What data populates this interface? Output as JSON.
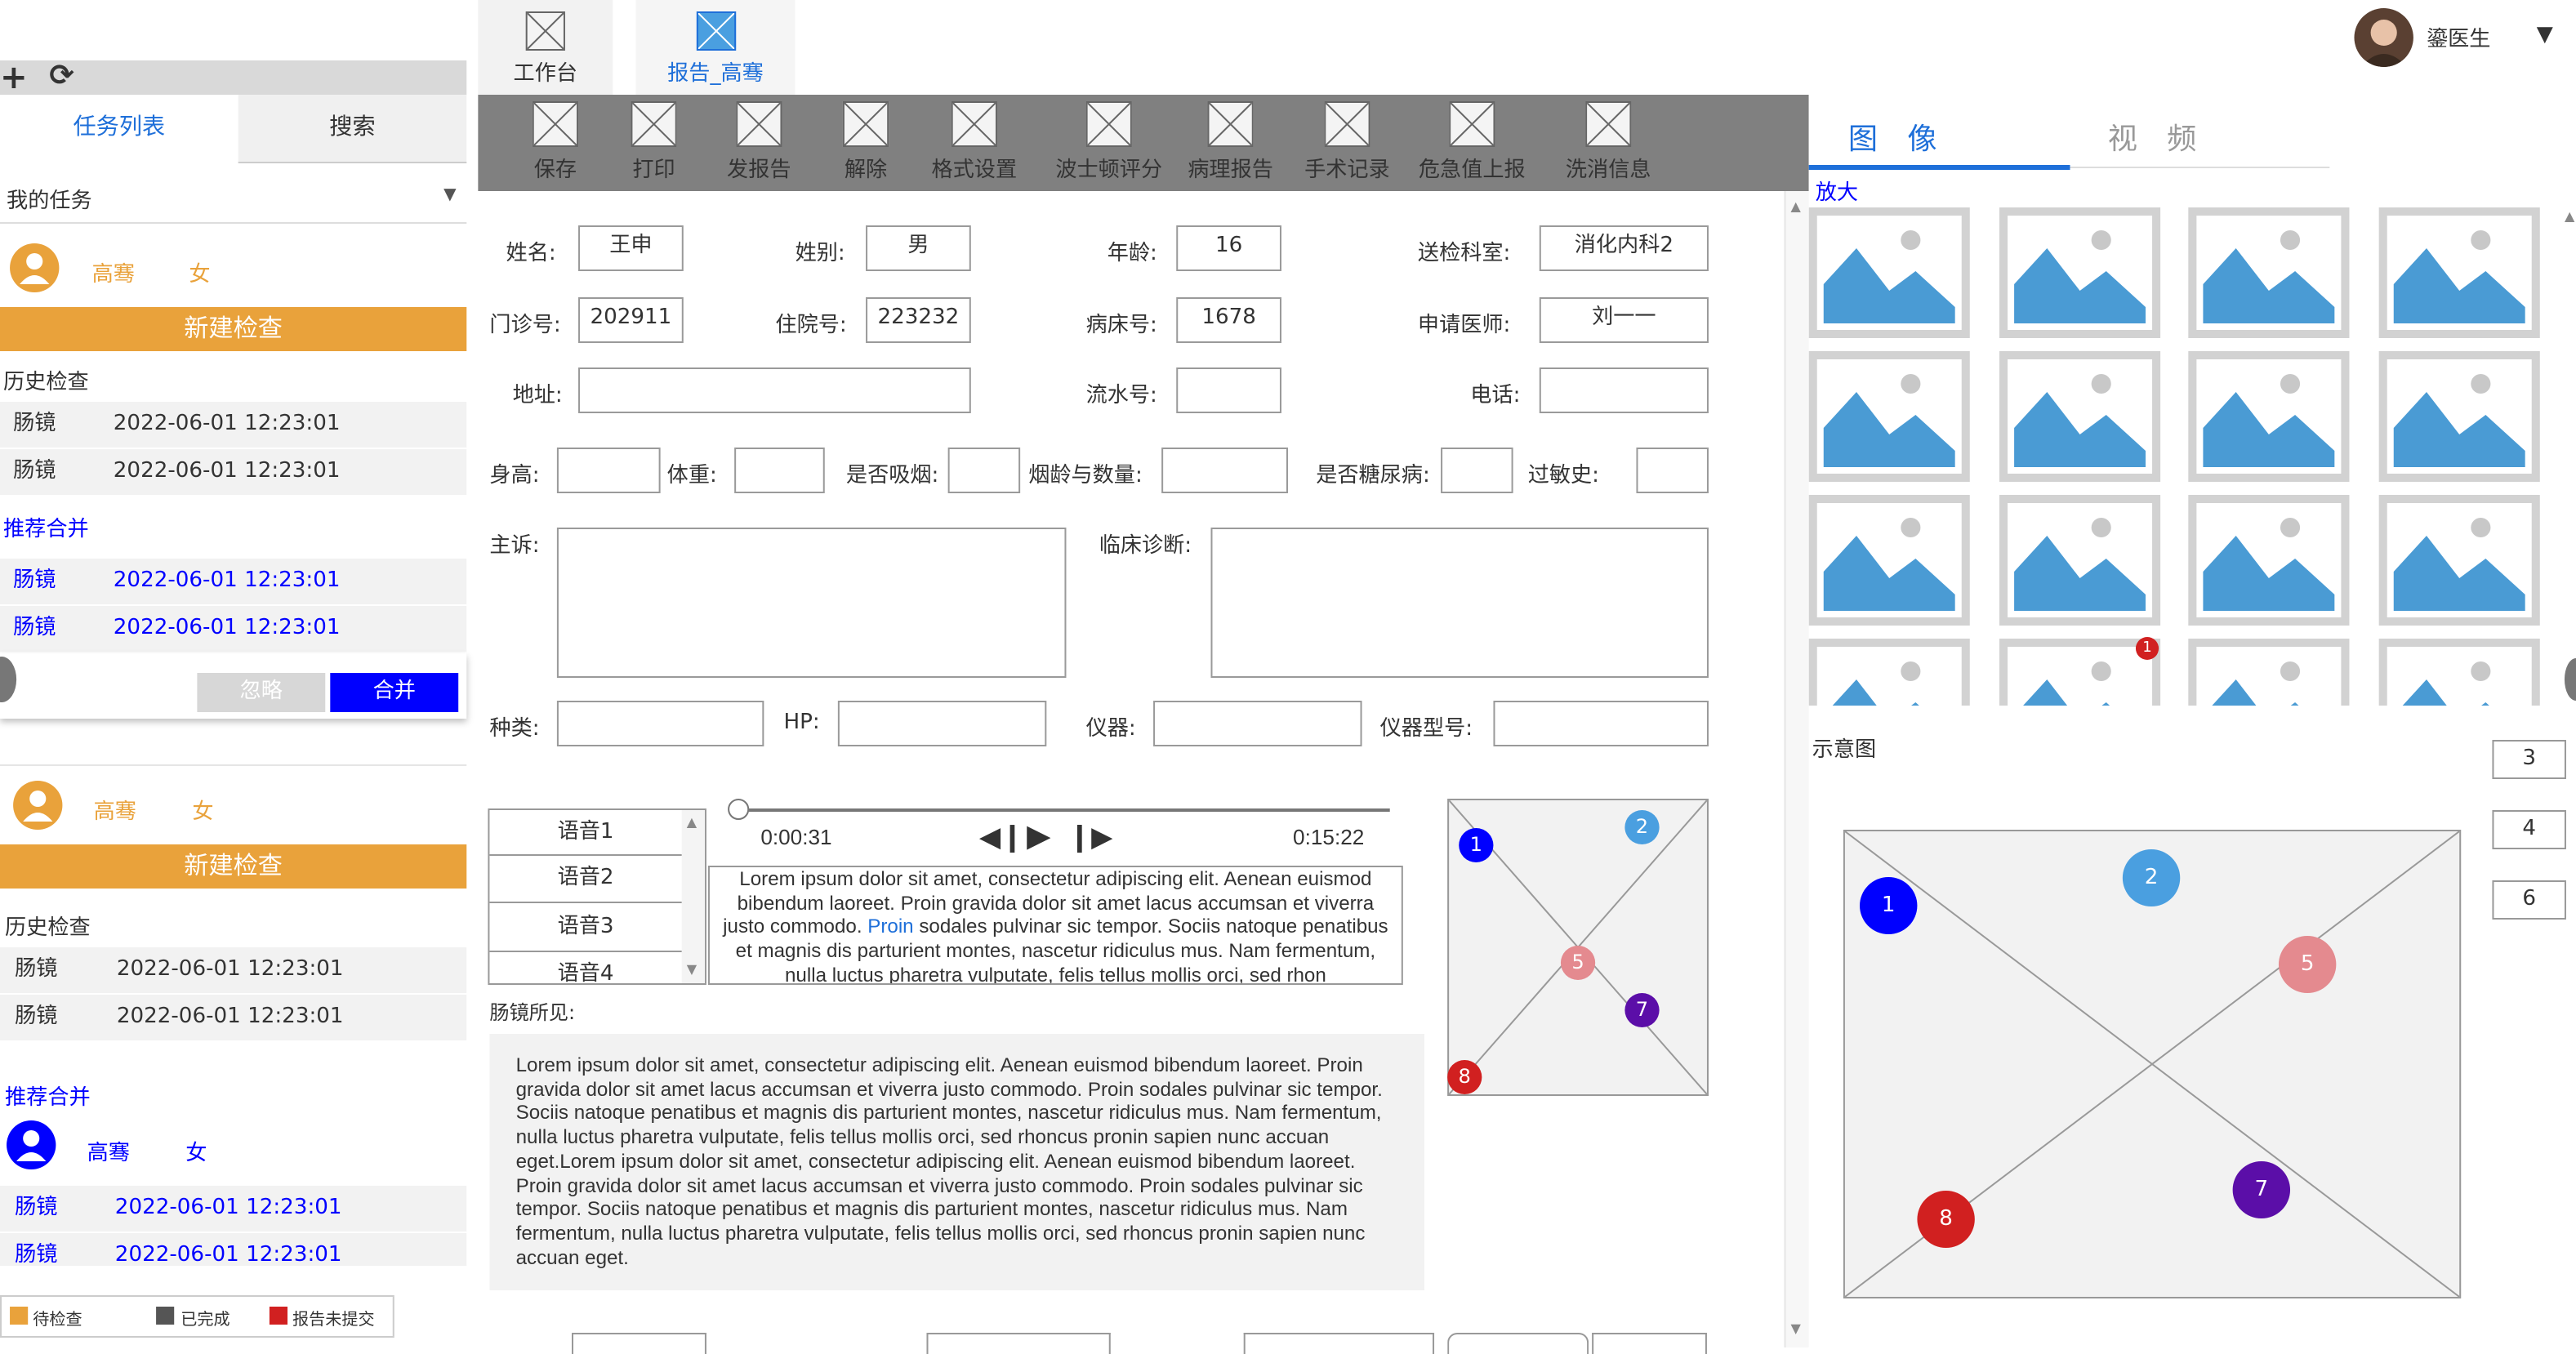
{
  "colors": {
    "orange": "#e9a23b",
    "blue_link": "#0000ff",
    "toolbar_bg": "#808080",
    "accent": "#1e6fd9",
    "marker_colors": {
      "1": "#0000ff",
      "2": "#4a9fe0",
      "5": "#e48a8f",
      "7": "#5b0ea8",
      "8": "#d12020"
    }
  },
  "top_tabs": [
    {
      "label": "工作台"
    },
    {
      "label": "报告_高骞"
    }
  ],
  "user": {
    "name": "鎏医生"
  },
  "left_panel": {
    "tab_tasks": "任务列表",
    "tab_search": "搜索",
    "my_tasks": "我的任务",
    "patient1": {
      "name": "高骞",
      "gender": "女"
    },
    "new_exam": "新建检查",
    "history_title": "历史检查",
    "history": [
      {
        "type": "肠镜",
        "time": "2022-06-01 12:23:01"
      },
      {
        "type": "肠镜",
        "time": "2022-06-01 12:23:01"
      }
    ],
    "merge_title": "推荐合并",
    "merge": [
      {
        "type": "肠镜",
        "time": "2022-06-01 12:23:01"
      },
      {
        "type": "肠镜",
        "time": "2022-06-01 12:23:01"
      }
    ],
    "ignore_btn": "忽略",
    "merge_btn": "合并",
    "patient2": {
      "name": "高骞",
      "gender": "女"
    },
    "new_exam2": "新建检查",
    "history_title2": "历史检查",
    "history2": [
      {
        "type": "肠镜",
        "time": "2022-06-01 12:23:01"
      },
      {
        "type": "肠镜",
        "time": "2022-06-01 12:23:01"
      }
    ],
    "merge_title2": "推荐合并",
    "patient3": {
      "name": "高骞",
      "gender": "女"
    },
    "merge2": [
      {
        "type": "肠镜",
        "time": "2022-06-01 12:23:01"
      },
      {
        "type": "肠镜",
        "time": "2022-06-01 12:23:01"
      }
    ],
    "legend": [
      {
        "label": "待检查",
        "color": "#e9a23b"
      },
      {
        "label": "已完成",
        "color": "#555555"
      },
      {
        "label": "报告未提交",
        "color": "#d12020"
      }
    ]
  },
  "toolbar": [
    "保存",
    "打印",
    "发报告",
    "解除",
    "格式设置",
    "波士顿评分",
    "病理报告",
    "手术记录",
    "危急值上报",
    "洗消信息"
  ],
  "form": {
    "name_label": "姓名:",
    "name": "王申",
    "gender_label": "姓别:",
    "gender": "男",
    "age_label": "年龄:",
    "age": "16",
    "dept_label": "送检科室:",
    "dept": "消化内科2",
    "clinic_label": "门诊号:",
    "clinic": "202911",
    "inpatient_label": "住院号:",
    "inpatient": "223232",
    "bed_label": "病床号:",
    "bed": "1678",
    "doctor_label": "申请医师:",
    "doctor": "刘一一",
    "address_label": "地址:",
    "address": "",
    "serial_label": "流水号:",
    "serial": "",
    "phone_label": "电话:",
    "phone": "",
    "height_label": "身高:",
    "weight_label": "体重:",
    "smoke_label": "是否吸烟:",
    "smoke_years_label": "烟龄与数量:",
    "diabetes_label": "是否糖尿病:",
    "allergy_label": "过敏史:",
    "complaint_label": "主诉:",
    "diagnosis_label": "临床诊断:",
    "kind_label": "种类:",
    "hp_label": "HP:",
    "device_label": "仪器:",
    "device_model_label": "仪器型号:"
  },
  "voice": {
    "items": [
      "语音1",
      "语音2",
      "语音3",
      "语音4"
    ],
    "current": "0:00:31",
    "total": "0:15:22",
    "progress": 0,
    "transcript_before": "Lorem ipsum dolor sit amet, consectetur adipiscing elit. Aenean euismod bibendum laoreet. Proin gravida dolor sit amet lacus accumsan et viverra justo commodo. ",
    "transcript_highlight": "Proin",
    "transcript_after": " sodales pulvinar sic tempor. Sociis natoque penatibus et magnis dis parturient montes, nascetur ridiculus mus. Nam fermentum, nulla luctus pharetra vulputate, felis tellus mollis orci, sed rhon"
  },
  "findings": {
    "label": "肠镜所见:",
    "text": "Lorem ipsum dolor sit amet, consectetur adipiscing elit. Aenean euismod bibendum laoreet. Proin gravida dolor sit amet lacus accumsan et viverra justo commodo. Proin sodales pulvinar sic tempor. Sociis natoque penatibus et magnis dis parturient montes, nascetur ridiculus mus. Nam fermentum, nulla luctus pharetra vulputate, felis tellus mollis orci, sed rhoncus pronin sapien nunc accuan eget.Lorem ipsum dolor sit amet, consectetur adipiscing elit. Aenean euismod bibendum laoreet. Proin gravida dolor sit amet lacus accumsan et viverra justo commodo. Proin sodales pulvinar sic tempor. Sociis natoque penatibus et magnis dis parturient montes, nascetur ridiculus mus. Nam fermentum, nulla luctus pharetra vulputate, felis tellus mollis orci, sed rhoncus pronin sapien nunc accuan eget."
  },
  "markers_small": [
    "1",
    "2",
    "5",
    "7",
    "8"
  ],
  "markers_large": [
    "1",
    "2",
    "5",
    "7",
    "8"
  ],
  "right_panel": {
    "tab_image": "图　像",
    "tab_video": "视　频",
    "zoom": "放大",
    "thumb_badge": "1",
    "diagram_label": "示意图",
    "side_numbers": [
      "3",
      "4",
      "6"
    ]
  }
}
